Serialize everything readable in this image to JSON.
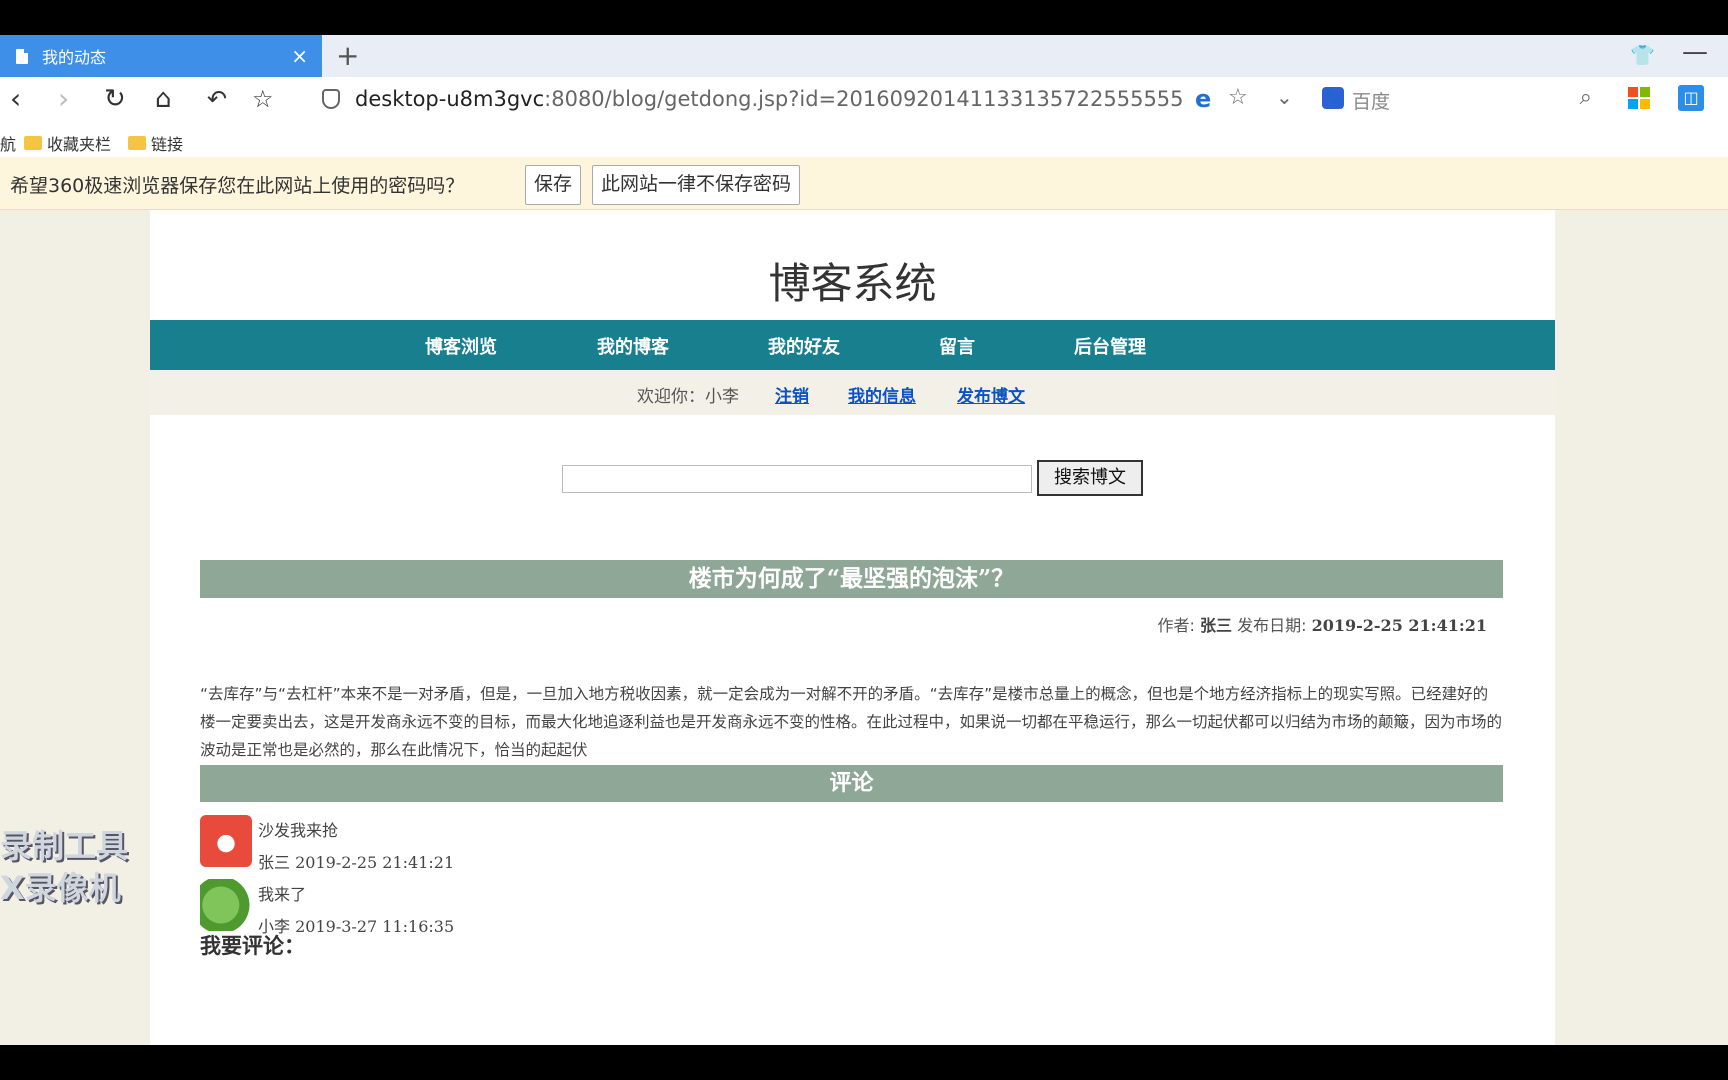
{
  "browser": {
    "tab_title": "我的动态",
    "url_host": "desktop-u8m3gvc",
    "url_rest": ":8080/blog/getdong.jsp?id=20160920141133135722555555",
    "search_placeholder": "百度",
    "bookmarks": [
      "收藏夹栏",
      "链接"
    ],
    "bookmark_partial": "航"
  },
  "password_bar": {
    "message": "希望360极速浏览器保存您在此网站上使用的密码吗？",
    "save_label": "保存",
    "never_label": "此网站一律不保存密码"
  },
  "site": {
    "title": "博客系统",
    "nav": [
      "博客浏览",
      "我的博客",
      "我的好友",
      "留言",
      "后台管理"
    ],
    "welcome": "欢迎你：小李",
    "user_links": [
      "注销",
      "我的信息",
      "发布博文"
    ],
    "search_button": "搜索博文"
  },
  "post": {
    "title": "楼市为何成了“最坚强的泡沫”？",
    "author_label": "作者:",
    "author": "张三",
    "date_label": "发布日期:",
    "date": "2019-2-25 21:41:21",
    "content": "“去库存”与“去杠杆”本来不是一对矛盾，但是，一旦加入地方税收因素，就一定会成为一对解不开的矛盾。“去库存”是楼市总量上的概念，但也是个地方经济指标上的现实写照。已经建好的楼一定要卖出去，这是开发商永远不变的目标，而最大化地追逐利益也是开发商永远不变的性格。在此过程中，如果说一切都在平稳运行，那么一切起伏都可以归结为市场的颠簸，因为市场的波动是正常也是必然的，那么在此情况下，恰当的起起伏"
  },
  "comments": {
    "header": "评论",
    "items": [
      {
        "text": "沙发我来抢",
        "user": "张三",
        "time": "2019-2-25 21:41:21",
        "avatar": "fox-avatar"
      },
      {
        "text": "我来了",
        "user": "小李",
        "time": "2019-3-27 11:16:35",
        "avatar": "lettuce-avatar"
      }
    ],
    "my_comment_label": "我要评论："
  },
  "overlay": {
    "watermark_line1": "录制工具",
    "watermark_line2": "X录像机"
  },
  "colors": {
    "tab_active": "#3e8fe8",
    "nav_bar": "#187f8f",
    "section_header": "#8fa796",
    "link": "#0b52c5",
    "page_bg": "#f2efe4"
  }
}
